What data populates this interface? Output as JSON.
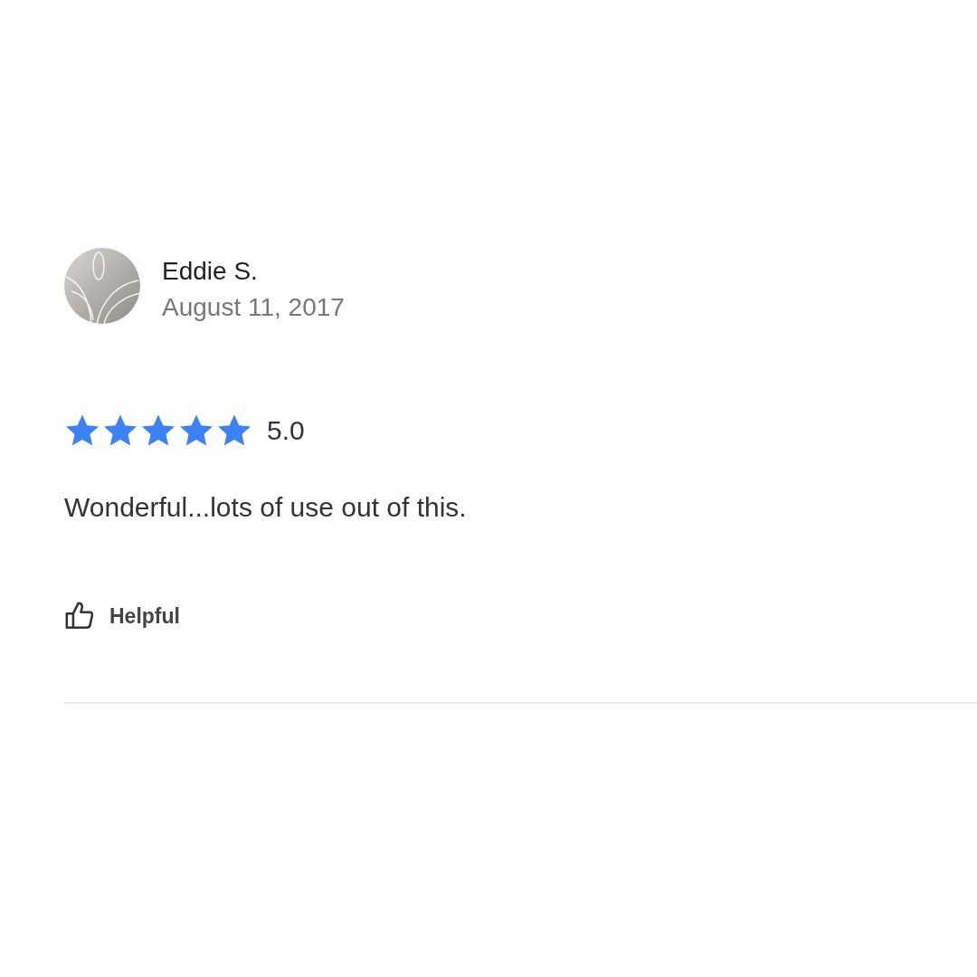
{
  "review": {
    "author": "Eddie S.",
    "date": "August 11, 2017",
    "stars": 5,
    "rating": "5.0",
    "text": "Wonderful...lots of use out of this.",
    "helpful_label": "Helpful"
  }
}
